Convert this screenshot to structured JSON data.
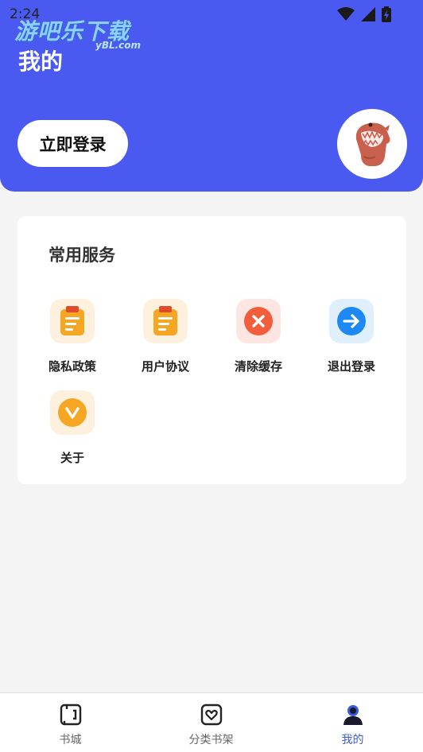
{
  "status_bar": {
    "time": "2:24"
  },
  "watermark": {
    "title": "游吧乐下载",
    "sub": "yBL.com"
  },
  "header": {
    "title": "我的",
    "login_label": "立即登录"
  },
  "services": {
    "title": "常用服务",
    "items": [
      {
        "label": "隐私政策",
        "icon": "clipboard-icon",
        "color": "#f5a623"
      },
      {
        "label": "用户协议",
        "icon": "clipboard-icon",
        "color": "#f5a623"
      },
      {
        "label": "清除缓存",
        "icon": "close-circle-icon",
        "color": "#f25d3c"
      },
      {
        "label": "退出登录",
        "icon": "arrow-right-circle-icon",
        "color": "#1e88f5"
      },
      {
        "label": "关于",
        "icon": "chevron-down-circle-icon",
        "color": "#f5a623"
      }
    ]
  },
  "tabbar": {
    "tabs": [
      {
        "label": "书城",
        "icon": "bookstore-icon"
      },
      {
        "label": "分类书架",
        "icon": "bookshelf-icon"
      },
      {
        "label": "我的",
        "icon": "profile-icon",
        "active": true
      }
    ]
  },
  "colors": {
    "primary": "#4a5af0",
    "active_tab": "#3b5bdb"
  }
}
